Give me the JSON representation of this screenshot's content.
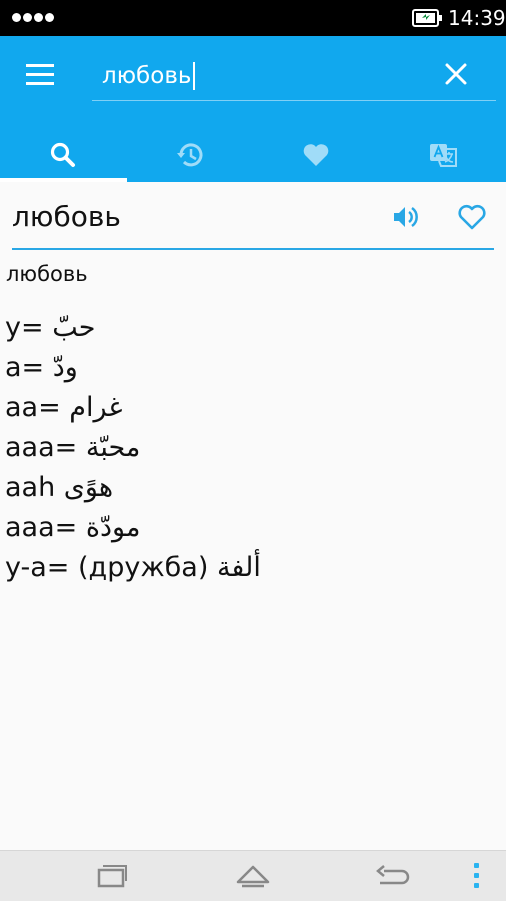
{
  "status_bar": {
    "time": "14:39",
    "icons": [
      "signal-dots-icon",
      "battery-charging-icon"
    ]
  },
  "search": {
    "value": "любовь",
    "icons": [
      "menu-icon",
      "clear-icon"
    ]
  },
  "tabs": [
    {
      "icon": "search-icon",
      "active": true
    },
    {
      "icon": "history-icon",
      "active": false
    },
    {
      "icon": "heart-icon",
      "active": false
    },
    {
      "icon": "translate-icon",
      "active": false
    }
  ],
  "word": {
    "title": "любовь",
    "icons": [
      "speaker-icon",
      "heart-outline-icon"
    ]
  },
  "entry": {
    "head": "любовь",
    "lines": [
      "y= حبّ",
      "a= ودّ",
      "aa= غرام",
      "aaa= محبّة",
      "aah هوًى",
      "aaa= مودّة",
      "y-a= (дружба) ألفة"
    ]
  },
  "colors": {
    "accent": "#11a8ee",
    "status_bar": "#000000",
    "navbar": "#e8e8e8",
    "divider": "#29a7e5"
  },
  "nav_bar": {
    "icons": [
      "recents-icon",
      "home-icon",
      "back-icon",
      "overflow-menu-icon"
    ]
  }
}
